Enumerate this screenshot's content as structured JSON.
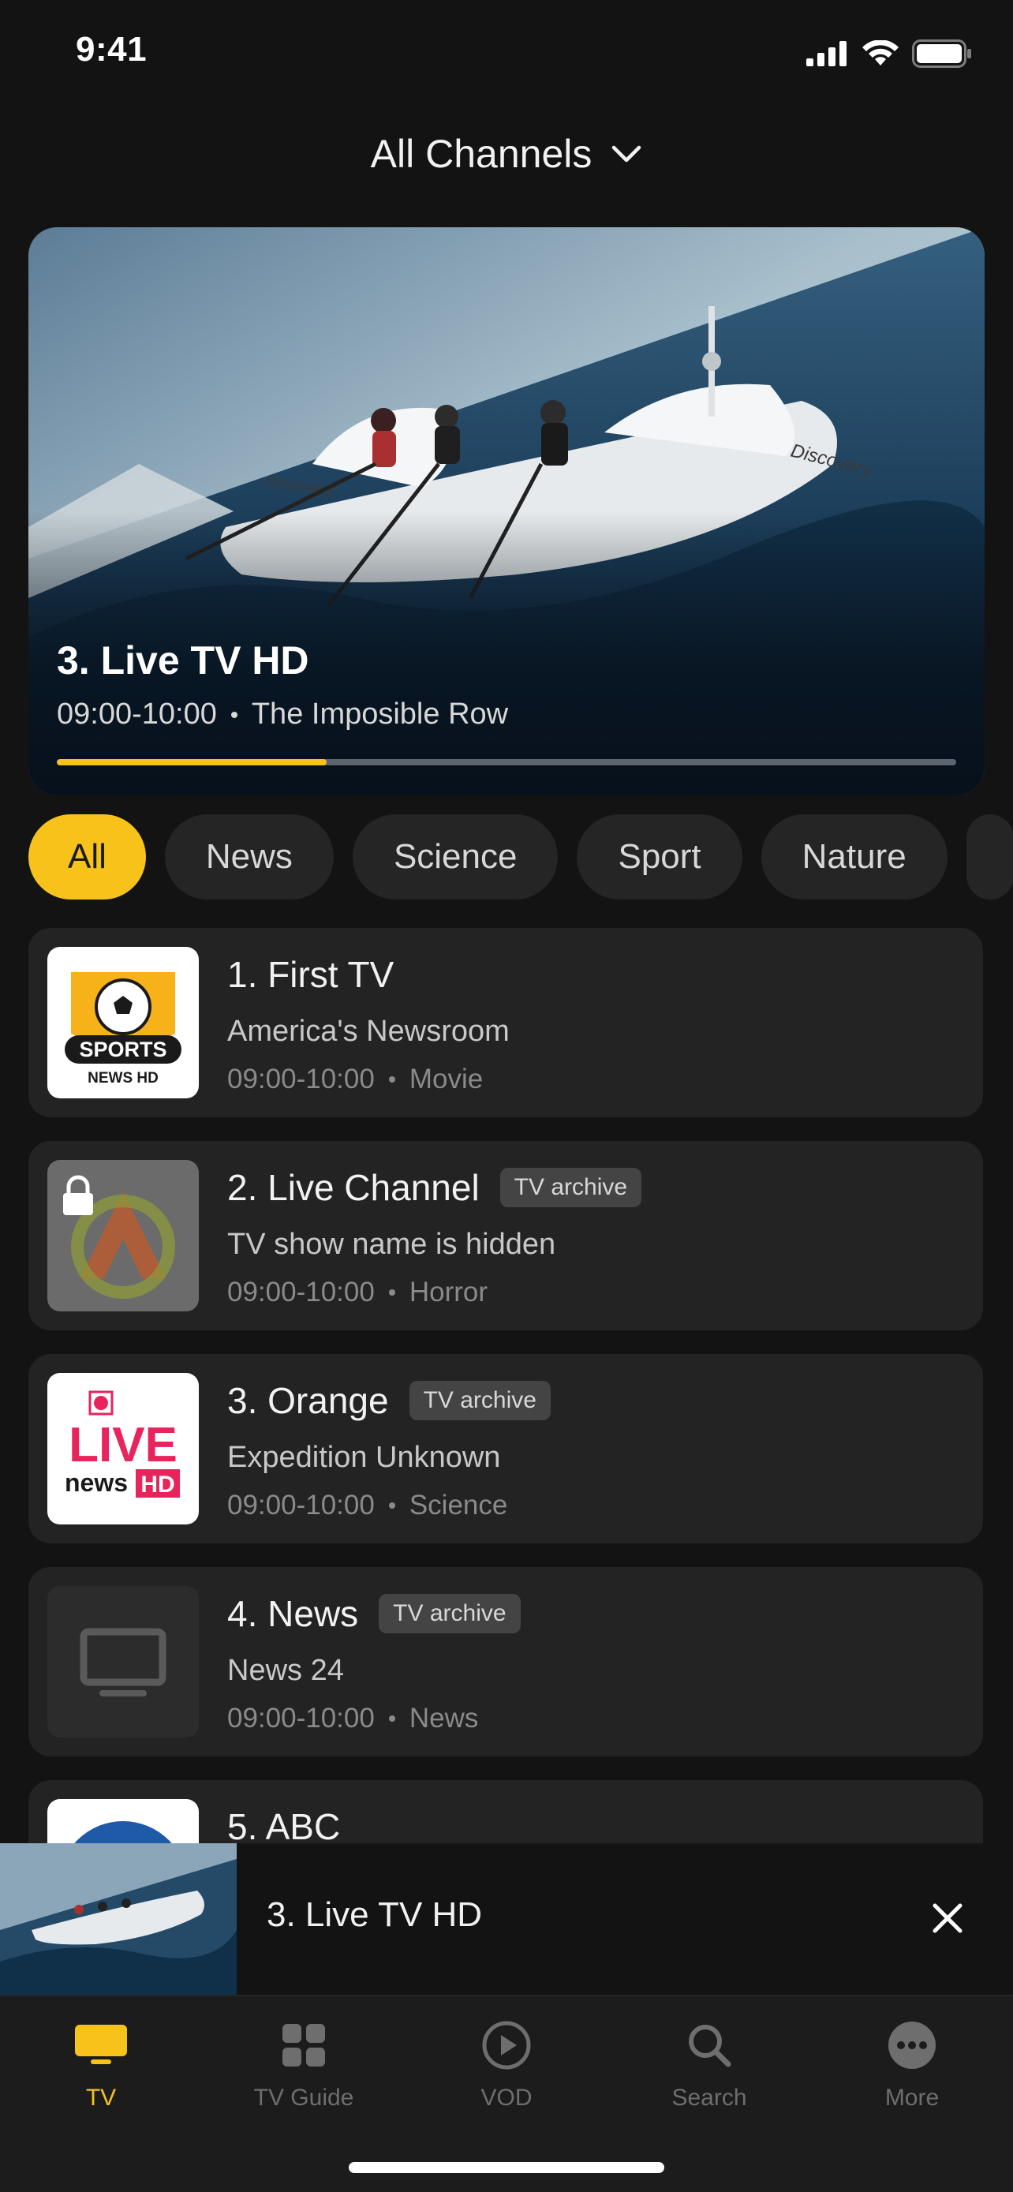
{
  "status_bar": {
    "time": "9:41"
  },
  "header": {
    "title": "All Channels",
    "dropdown_icon": "chevron-down-icon"
  },
  "hero": {
    "title": "3. Live TV HD",
    "time": "09:00-10:00",
    "program": "The Imposible Row",
    "progress": 0.3,
    "boat_brand": "Discovery"
  },
  "categories": [
    "All",
    "News",
    "Science",
    "Sport",
    "Nature"
  ],
  "channels": [
    {
      "title": "1. First TV",
      "badge": "",
      "program": "America's Newsroom",
      "time": "09:00-10:00",
      "genre": "Movie",
      "logo": "sports-news-logo",
      "logo_text": "SPORTS",
      "logo_sub": "NEWS HD"
    },
    {
      "title": "2. Live Channel",
      "badge": "TV archive",
      "program": "TV show name is hidden",
      "time": "09:00-10:00",
      "genre": "Horror",
      "logo": "locked-channel-logo"
    },
    {
      "title": "3. Orange",
      "badge": "TV archive",
      "program": "Expedition Unknown",
      "time": "09:00-10:00",
      "genre": "Science",
      "logo": "live-news-logo",
      "logo_text": "LIVE",
      "logo_sub": "news",
      "logo_hd": "HD"
    },
    {
      "title": "4. News",
      "badge": "TV archive",
      "program": "News 24",
      "time": "09:00-10:00",
      "genre": "News",
      "logo": "tv-placeholder-icon"
    },
    {
      "title": "5. ABC",
      "badge": "",
      "program": "",
      "time": "",
      "genre": "",
      "logo": "abc-logo"
    }
  ],
  "mini_player": {
    "title": "3. Live TV HD"
  },
  "tabs": [
    {
      "label": "TV",
      "icon": "tv-icon",
      "active": true
    },
    {
      "label": "TV Guide",
      "icon": "grid-icon",
      "active": false
    },
    {
      "label": "VOD",
      "icon": "play-circle-icon",
      "active": false
    },
    {
      "label": "Search",
      "icon": "search-icon",
      "active": false
    },
    {
      "label": "More",
      "icon": "more-icon",
      "active": false
    }
  ],
  "colors": {
    "accent": "#f7c21a",
    "background": "#131313",
    "card": "#232323"
  }
}
